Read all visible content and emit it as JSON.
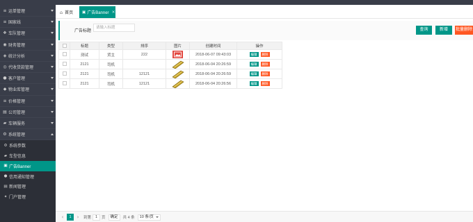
{
  "theme": {
    "accent": "#009688",
    "danger": "#FF5722",
    "sidebar_bg": "#393D49"
  },
  "sidebar": {
    "items": [
      {
        "label": "运单管理",
        "icon": "list-icon"
      },
      {
        "label": "国家线",
        "icon": "route-icon"
      },
      {
        "label": "车队管理",
        "icon": "fleet-icon"
      },
      {
        "label": "财务管理",
        "icon": "finance-icon"
      },
      {
        "label": "统计分析",
        "icon": "chart-icon"
      },
      {
        "label": "代收货款管理",
        "icon": "cod-icon"
      },
      {
        "label": "客户管理",
        "icon": "user-icon"
      },
      {
        "label": "物业库管理",
        "icon": "location-icon"
      },
      {
        "label": "价格管理",
        "icon": "price-icon"
      },
      {
        "label": "公司管理",
        "icon": "company-icon"
      },
      {
        "label": "车辆服务",
        "icon": "car-icon"
      },
      {
        "label": "系统管理",
        "icon": "gear-icon",
        "expanded": true
      }
    ],
    "children": [
      {
        "label": "系统参数",
        "icon": "gear-icon"
      },
      {
        "label": "车型信息",
        "icon": "car-icon"
      },
      {
        "label": "广告Banner",
        "icon": "image-icon",
        "selected": true
      },
      {
        "label": "信用通知管理",
        "icon": "dot-icon"
      },
      {
        "label": "新闻管理",
        "icon": "news-icon"
      },
      {
        "label": "门户管理",
        "icon": "star-icon"
      }
    ]
  },
  "tabs": [
    {
      "label": "首页",
      "icon": "home-icon"
    },
    {
      "label": "广告Banner",
      "icon": "image-icon",
      "active": true,
      "closable": true
    }
  ],
  "search": {
    "label": "广告标题",
    "placeholder": "请输入标题"
  },
  "toolbar": {
    "query": "查询",
    "add": "新增",
    "batch_delete": "批量删除"
  },
  "table": {
    "headers": {
      "title": "标题",
      "type": "类型",
      "sort": "排序",
      "image": "图片",
      "created": "创建时间",
      "actions": "操作"
    },
    "rows": [
      {
        "title": "测试",
        "type": "货主",
        "sort": "222",
        "image": "red-picture-thumbnail",
        "created": "2018-06-07 09:43:03"
      },
      {
        "title": "2121",
        "type": "司机",
        "sort": "",
        "image": "gold-stripe-thumbnail",
        "created": "2018-06-04 20:26:59"
      },
      {
        "title": "2121",
        "type": "司机",
        "sort": "12121",
        "image": "gold-stripe-thumbnail",
        "created": "2018-06-04 20:26:59"
      },
      {
        "title": "2121",
        "type": "司机",
        "sort": "12121",
        "image": "gold-stripe-thumbnail",
        "created": "2018-06-04 20:26:56"
      }
    ],
    "row_actions": {
      "edit": "编辑",
      "delete": "删除"
    }
  },
  "pagination": {
    "current": "1",
    "goto_prefix": "到第",
    "goto_value": "1",
    "goto_suffix": "页",
    "confirm": "确定",
    "total": "共 4 条",
    "page_size": "10 条/页"
  }
}
